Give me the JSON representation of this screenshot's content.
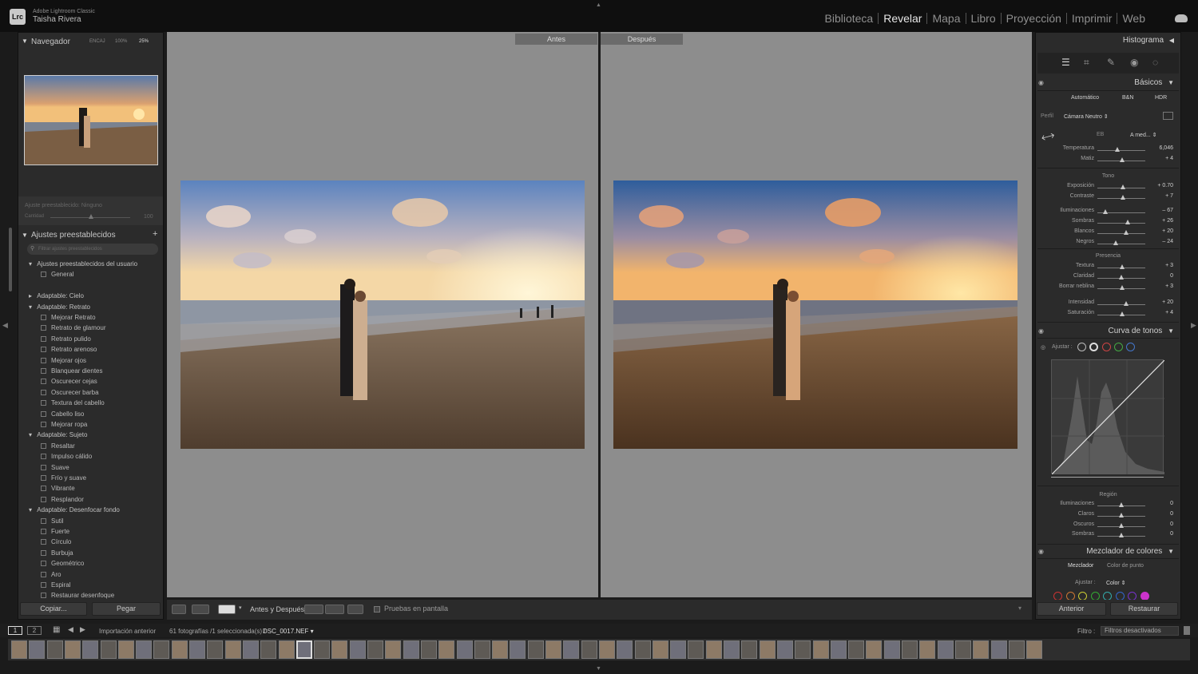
{
  "app": {
    "logo": "Lrc",
    "name": "Adobe Lightroom Classic",
    "user": "Taisha Rivera"
  },
  "modules": [
    "Biblioteca",
    "Revelar",
    "Mapa",
    "Libro",
    "Proyección",
    "Imprimir",
    "Web"
  ],
  "active_module": "Revelar",
  "navigator": {
    "title": "Navegador",
    "zoom_options": [
      "ENCAJ",
      "100%",
      "25%"
    ]
  },
  "preset_amount": {
    "label": "Ajuste preestablecido: Ninguno",
    "amount_label": "Cantidad",
    "amount_value": "100"
  },
  "presets": {
    "title": "Ajustes preestablecidos",
    "add": "+",
    "search_placeholder": "Filtrar ajustes preestablecidos",
    "groups": [
      {
        "name": "Ajustes preestablecidos del usuario",
        "expanded": true,
        "items": [
          "General"
        ]
      },
      {
        "name": "Adaptable: Cielo",
        "expanded": false,
        "items": []
      },
      {
        "name": "Adaptable: Retrato",
        "expanded": true,
        "items": [
          "Mejorar Retrato",
          "Retrato de glamour",
          "Retrato pulido",
          "Retrato arenoso",
          "Mejorar ojos",
          "Blanquear dientes",
          "Oscurecer cejas",
          "Oscurecer barba",
          "Textura del cabello",
          "Cabello liso",
          "Mejorar ropa"
        ]
      },
      {
        "name": "Adaptable: Sujeto",
        "expanded": true,
        "items": [
          "Resaltar",
          "Impulso cálido",
          "Suave",
          "Frío y suave",
          "Vibrante",
          "Resplandor"
        ]
      },
      {
        "name": "Adaptable: Desenfocar fondo",
        "expanded": true,
        "items": [
          "Sutil",
          "Fuerte",
          "Círculo",
          "Burbuja",
          "Geométrico",
          "Aro",
          "Espiral",
          "Restaurar desenfoque"
        ]
      }
    ]
  },
  "left_buttons": {
    "copy": "Copiar...",
    "paste": "Pegar"
  },
  "compare": {
    "before": "Antes",
    "after": "Después"
  },
  "toolbar": {
    "before_after_label": "Antes y Después:",
    "softproof_label": "Pruebas en pantalla"
  },
  "right_panel": {
    "histogram_title": "Histograma",
    "basics_title": "Básicos",
    "treatment_buttons": [
      "Automático",
      "B&N",
      "HDR"
    ],
    "profile_label": "Perfil",
    "profile_value": "Cámara Neutro",
    "wb_label": "EB",
    "wb_value": "A med...",
    "tone_label": "Tono",
    "presence_label": "Presencia",
    "sliders_wb": [
      {
        "label": "Temperatura",
        "value": "6,046",
        "pos": 0.42
      },
      {
        "label": "Matiz",
        "value": "+ 4",
        "pos": 0.51
      }
    ],
    "sliders_tone": [
      {
        "label": "Exposición",
        "value": "+ 0.70",
        "pos": 0.53
      },
      {
        "label": "Contraste",
        "value": "+ 7",
        "pos": 0.53
      },
      {
        "label": "Iluminaciones",
        "value": "– 67",
        "pos": 0.17
      },
      {
        "label": "Sombras",
        "value": "+ 26",
        "pos": 0.63
      },
      {
        "label": "Blancos",
        "value": "+ 20",
        "pos": 0.6
      },
      {
        "label": "Negros",
        "value": "– 24",
        "pos": 0.38
      }
    ],
    "sliders_presence": [
      {
        "label": "Textura",
        "value": "+ 3",
        "pos": 0.52
      },
      {
        "label": "Claridad",
        "value": "0",
        "pos": 0.5
      },
      {
        "label": "Borrar neblina",
        "value": "+ 3",
        "pos": 0.52
      },
      {
        "label": "Intensidad",
        "value": "+ 20",
        "pos": 0.6
      },
      {
        "label": "Saturación",
        "value": "+ 4",
        "pos": 0.52
      }
    ],
    "curve_title": "Curva de tonos",
    "curve_adjust": "Ajustar :",
    "region_label": "Región",
    "sliders_region": [
      {
        "label": "Iluminaciones",
        "value": "0",
        "pos": 0.5
      },
      {
        "label": "Claros",
        "value": "0",
        "pos": 0.5
      },
      {
        "label": "Oscuros",
        "value": "0",
        "pos": 0.5
      },
      {
        "label": "Sombras",
        "value": "0",
        "pos": 0.5
      }
    ],
    "mixer_title": "Mezclador de colores",
    "mixer_tabs": [
      "Mezclador",
      "Color de punto"
    ],
    "mixer_adjust": "Ajustar :",
    "mixer_adjust_value": "Color",
    "buttons": {
      "previous": "Anterior",
      "reset": "Restaurar"
    }
  },
  "filmstrip": {
    "view_numbers": [
      "1",
      "2"
    ],
    "source": "Importación anterior",
    "info": "61 fotografías /1 seleccionada(s) /",
    "filename": "DSC_0017.NEF",
    "filter_label": "Filtro :",
    "filter_value": "Filtros desactivados",
    "thumb_count": 58
  }
}
